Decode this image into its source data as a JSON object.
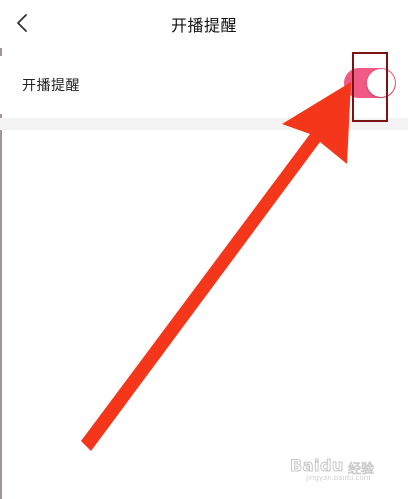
{
  "header": {
    "title": "开播提醒",
    "back_icon": "chevron-left-icon"
  },
  "settings": {
    "live_reminder": {
      "label": "开播提醒",
      "enabled": true
    }
  },
  "colors": {
    "toggle_on": "#f05a85",
    "annotation_arrow": "#f4361b",
    "annotation_box": "#7a1414",
    "divider": "#f3f3f3"
  },
  "watermark": {
    "brand": "Baidu",
    "sub": "经验",
    "url": "jingyan.baidu.com"
  }
}
